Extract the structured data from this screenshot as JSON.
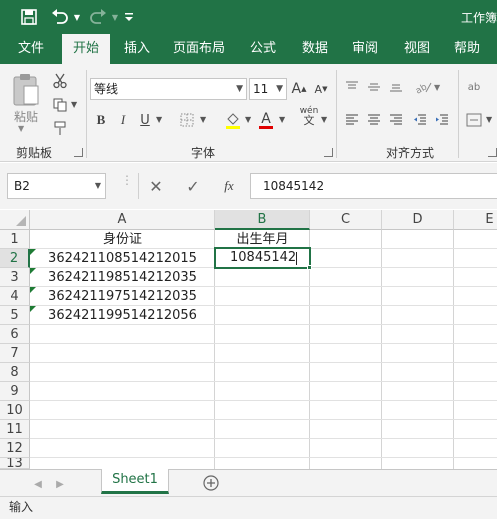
{
  "title_bar": {
    "title": "工作簿",
    "icons": [
      "save-icon",
      "undo-icon",
      "redo-icon",
      "customize-qat-icon"
    ]
  },
  "tabs": [
    "文件",
    "开始",
    "插入",
    "页面布局",
    "公式",
    "数据",
    "审阅",
    "视图",
    "帮助"
  ],
  "active_tab": "开始",
  "ribbon": {
    "clipboard": {
      "paste_label": "粘贴",
      "group_label": "剪贴板"
    },
    "font": {
      "font_name": "等线",
      "font_size": "11",
      "bold": "B",
      "italic": "I",
      "underline": "U",
      "font_color_glyph": "A",
      "phonetic": "wén",
      "group_label": "字体"
    },
    "alignment": {
      "group_label": "对齐方式",
      "wrap_glyph": "ab"
    }
  },
  "formula_bar": {
    "name_box": "B2",
    "fx": "fx",
    "value": "10845142"
  },
  "columns": [
    "A",
    "B",
    "C",
    "D",
    "E"
  ],
  "rows": [
    "1",
    "2",
    "3",
    "4",
    "5",
    "6",
    "7",
    "8",
    "9",
    "10",
    "11",
    "12",
    "13"
  ],
  "cells": {
    "A1": "身份证",
    "B1": "出生年月",
    "A2": "362421108514212015",
    "B2": "10845142",
    "A3": "362421198514212035",
    "A4": "362421197514212035",
    "A5": "362421199514212056"
  },
  "active_cell": "B2",
  "sheet_tabs": [
    "Sheet1"
  ],
  "status": "输入",
  "colors": {
    "excel_green": "#217346",
    "error_triangle": "#1e7b34"
  }
}
